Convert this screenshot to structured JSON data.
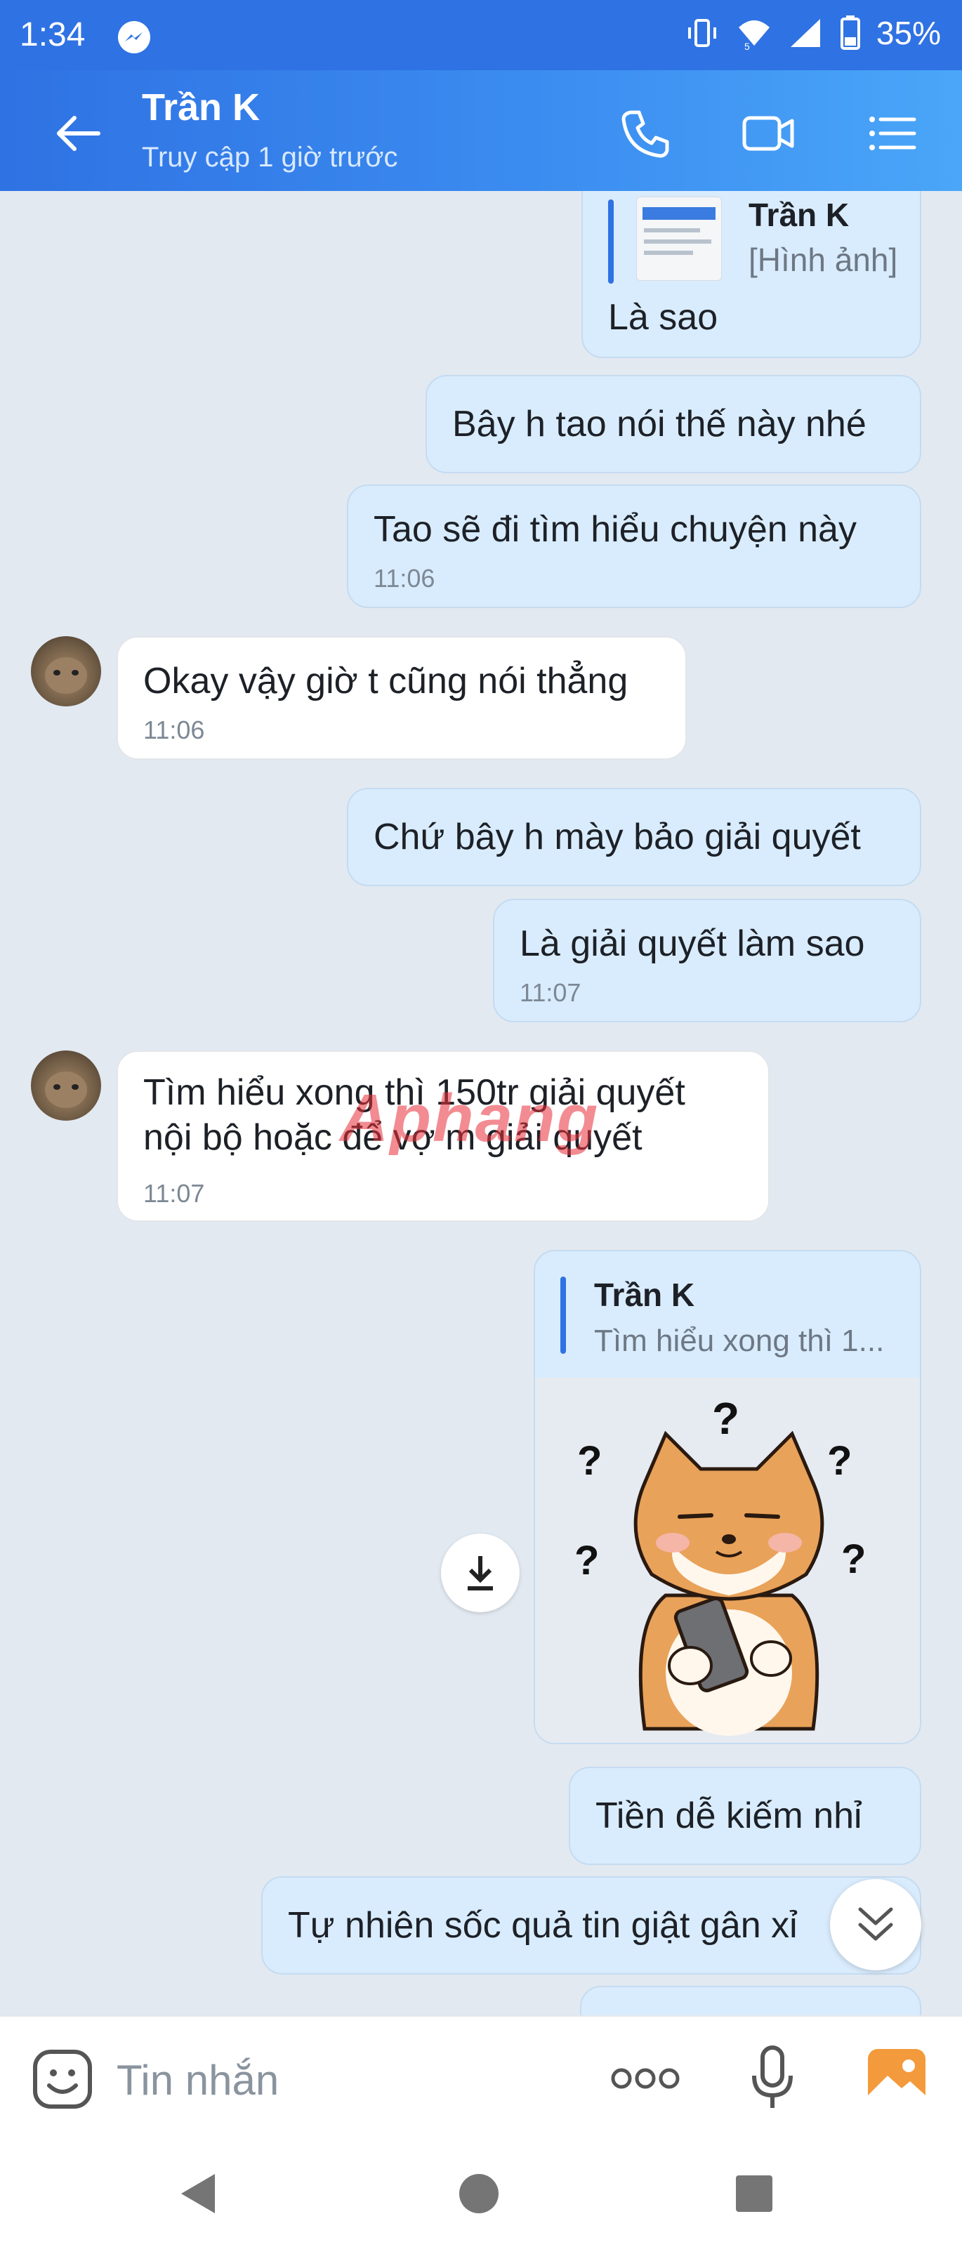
{
  "status_bar": {
    "time": "1:34",
    "battery": "35%",
    "network": "5"
  },
  "header": {
    "contact_name": "Trần K",
    "last_seen": "Truy cập 1 giờ trước"
  },
  "messages": {
    "quoted_image_reply": {
      "quote_name": "Trần K",
      "quote_preview": "[Hình ảnh]",
      "text": "Là sao"
    },
    "m1": {
      "text": "Bây h tao nói thế này nhé"
    },
    "m2": {
      "text": "Tao sẽ đi tìm hiểu chuyện này",
      "time": "11:06"
    },
    "m3": {
      "text": "Okay vậy giờ t cũng nói thẳng",
      "time": "11:06"
    },
    "m4": {
      "text": "Chứ bây h mày bảo giải quyết"
    },
    "m5": {
      "text": "Là giải quyết làm sao",
      "time": "11:07"
    },
    "m6": {
      "line1": "Tìm hiểu xong thì 150tr giải quyết",
      "line2": "nội bộ hoặc để vợ m giải quyết",
      "time": "11:07"
    },
    "sticker_reply": {
      "quote_name": "Trần K",
      "quote_preview": "Tìm hiểu xong thì 1...",
      "marks": [
        "?",
        "?",
        "?",
        "?",
        "?"
      ]
    },
    "m7": {
      "text": "Tiền dễ kiếm nhỉ"
    },
    "m8": {
      "text": "Tự nhiên sốc quả tin giật gân xỉ"
    }
  },
  "watermark": {
    "text": "Aphang"
  },
  "input": {
    "placeholder": "Tin nhắn"
  },
  "colors": {
    "header_start": "#2f72e3",
    "header_end": "#4aa6f8",
    "my_bubble": "#d9ecfd",
    "their_bubble": "#ffffff",
    "chat_bg": "#e2e9f1",
    "accent": "#2f72e3"
  },
  "icons": {
    "back": "arrow-left-icon",
    "call": "phone-icon",
    "video": "video-camera-icon",
    "menu": "list-menu-icon",
    "download": "download-icon",
    "scroll_down": "double-chevron-down-icon",
    "sticker": "emoji-face-icon",
    "more": "more-dots-icon",
    "mic": "microphone-icon",
    "gallery": "gallery-image-icon",
    "nav_back": "nav-back-icon",
    "nav_home": "nav-home-icon",
    "nav_recent": "nav-recent-icon"
  }
}
